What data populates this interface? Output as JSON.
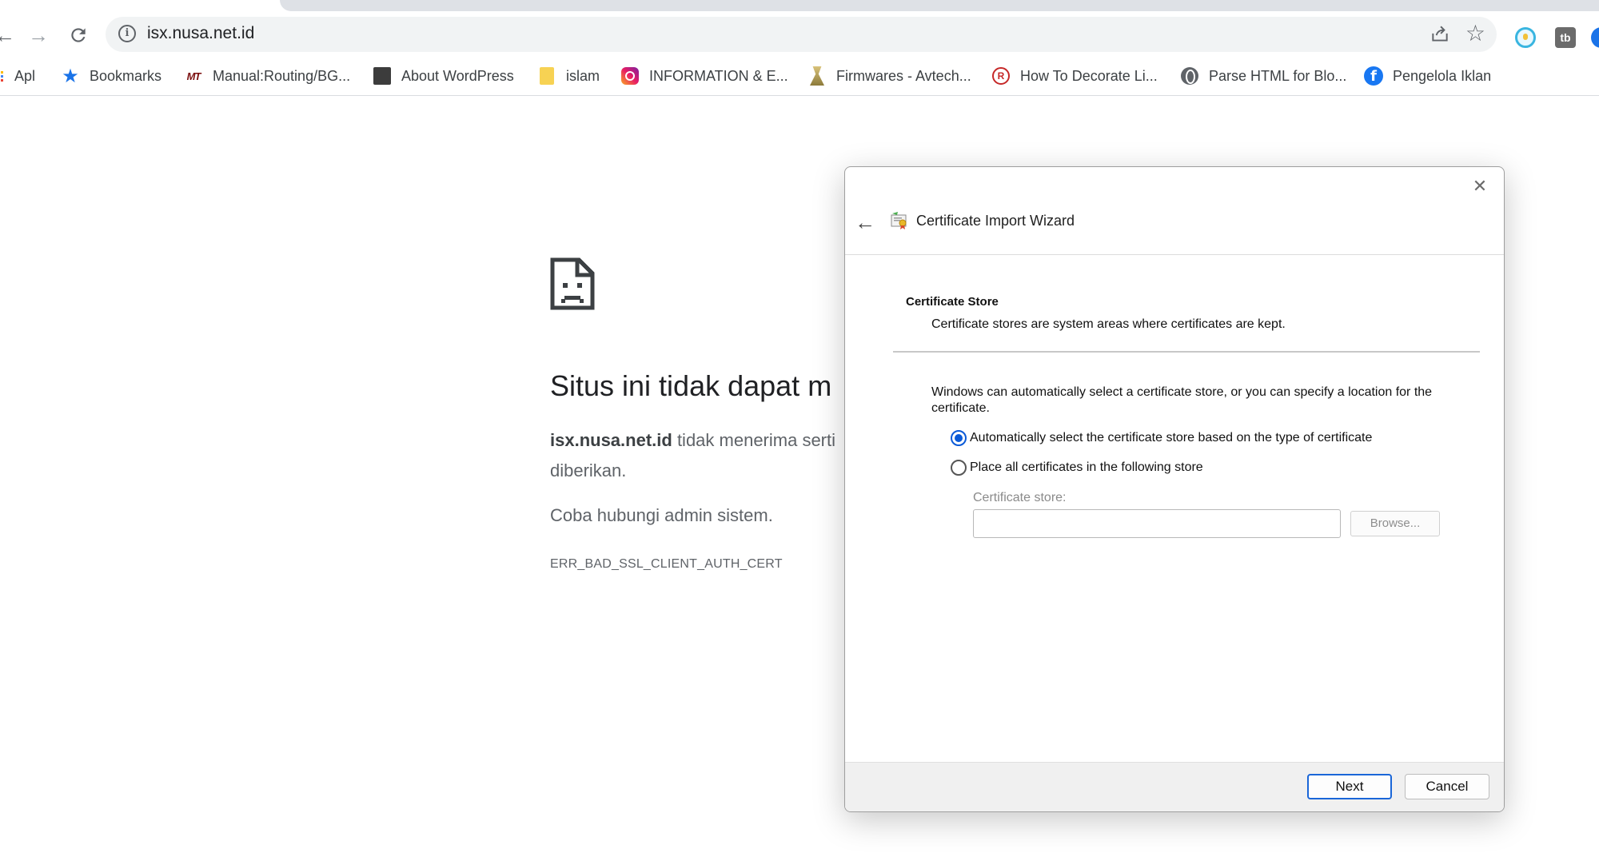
{
  "browser": {
    "url": "isx.nusa.net.id",
    "ext_tb_label": "tb"
  },
  "bookmarks": [
    {
      "label": "Apl",
      "icon": "apps-grid-icon"
    },
    {
      "label": "Bookmarks",
      "icon": "star-icon"
    },
    {
      "label": "Manual:Routing/BG...",
      "icon": "mikrotik-icon",
      "icon_text": "MT"
    },
    {
      "label": "About WordPress",
      "icon": "wordpress-icon"
    },
    {
      "label": "islam",
      "icon": "folder-icon"
    },
    {
      "label": "INFORMATION & E...",
      "icon": "instagram-icon"
    },
    {
      "label": "Firmwares - Avtech...",
      "icon": "firmware-icon"
    },
    {
      "label": "How To Decorate Li...",
      "icon": "r-logo-icon",
      "icon_text": "R"
    },
    {
      "label": "Parse HTML for Blo...",
      "icon": "globe-icon"
    },
    {
      "label": "Pengelola Iklan",
      "icon": "facebook-icon",
      "icon_text": "f"
    }
  ],
  "error_page": {
    "title": "Situs ini tidak dapat m",
    "host": "isx.nusa.net.id",
    "body_line1": " tidak menerima serti",
    "body_line2": "diberikan.",
    "hint": "Coba hubungi admin sistem.",
    "code": "ERR_BAD_SSL_CLIENT_AUTH_CERT"
  },
  "wizard": {
    "title": "Certificate Import Wizard",
    "section_title": "Certificate Store",
    "section_desc": "Certificate stores are system areas where certificates are kept.",
    "paragraph": "Windows can automatically select a certificate store, or you can specify a location for the certificate.",
    "radio_auto": "Automatically select the certificate store based on the type of certificate",
    "radio_manual": "Place all certificates in the following store",
    "selected_option": "auto",
    "store_label": "Certificate store:",
    "store_value": "",
    "browse_label": "Browse...",
    "next_label": "Next",
    "cancel_label": "Cancel",
    "close_glyph": "✕",
    "back_glyph": "←"
  },
  "colors": {
    "accent": "#1a73e8",
    "radio_selected": "#0a5ad8"
  }
}
